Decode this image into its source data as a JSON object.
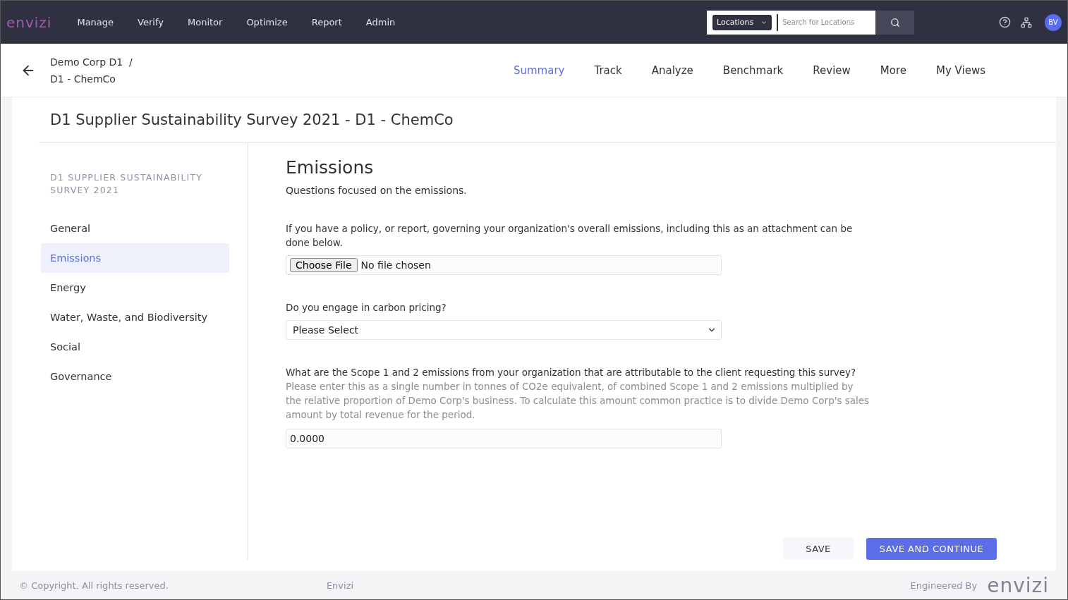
{
  "topbar": {
    "logo": "envizi",
    "menu": [
      {
        "label": "Manage"
      },
      {
        "label": "Verify"
      },
      {
        "label": "Monitor"
      },
      {
        "label": "Optimize"
      },
      {
        "label": "Report"
      },
      {
        "label": "Admin"
      }
    ],
    "search": {
      "scope": "Locations",
      "placeholder": "Search for Locations"
    },
    "avatar": "BV"
  },
  "breadcrumb": {
    "parent": "Demo Corp D1",
    "separator": "/",
    "current": "D1 - ChemCo"
  },
  "tabs": [
    {
      "label": "Summary",
      "selected": true
    },
    {
      "label": "Track",
      "selected": false
    },
    {
      "label": "Analyze",
      "selected": false
    },
    {
      "label": "Benchmark",
      "selected": false
    },
    {
      "label": "Review",
      "selected": false
    },
    {
      "label": "More",
      "selected": false
    },
    {
      "label": "My Views",
      "selected": false
    }
  ],
  "page_title": "D1 Supplier Sustainability Survey 2021 - D1 - ChemCo",
  "sidebar": {
    "heading": "D1 SUPPLIER SUSTAINABILITY SURVEY 2021",
    "items": [
      {
        "label": "General",
        "selected": false
      },
      {
        "label": "Emissions",
        "selected": true
      },
      {
        "label": "Energy",
        "selected": false
      },
      {
        "label": "Water, Waste, and Biodiversity",
        "selected": false
      },
      {
        "label": "Social",
        "selected": false
      },
      {
        "label": "Governance",
        "selected": false
      }
    ]
  },
  "section": {
    "title": "Emissions",
    "description": "Questions focused on the emissions.",
    "questions": [
      {
        "kind": "file",
        "label": "If you have a policy, or report, governing your organization's overall emissions, including this as an attachment can be done below.",
        "button": "Choose File",
        "status": "No file chosen"
      },
      {
        "kind": "select",
        "label": "Do you engage in carbon pricing?",
        "value": "Please Select"
      },
      {
        "kind": "number",
        "label": "What are the Scope 1 and 2 emissions from your organization that are attributable to the client requesting this survey?",
        "help": "Please enter this as a single number in tonnes of CO2e equivalent, of combined Scope 1 and 2 emissions multiplied by the relative proportion of Demo Corp's business. To calculate this amount common practice is to divide Demo Corp's sales amount by total revenue for the period.",
        "value": "0.0000"
      }
    ]
  },
  "actions": {
    "save": "SAVE",
    "save_continue": "SAVE AND CONTINUE"
  },
  "footer": {
    "copyright": "© Copyright. All rights reserved.",
    "center": "Envizi",
    "engineered": "Engineered By",
    "logo": "envizi"
  }
}
